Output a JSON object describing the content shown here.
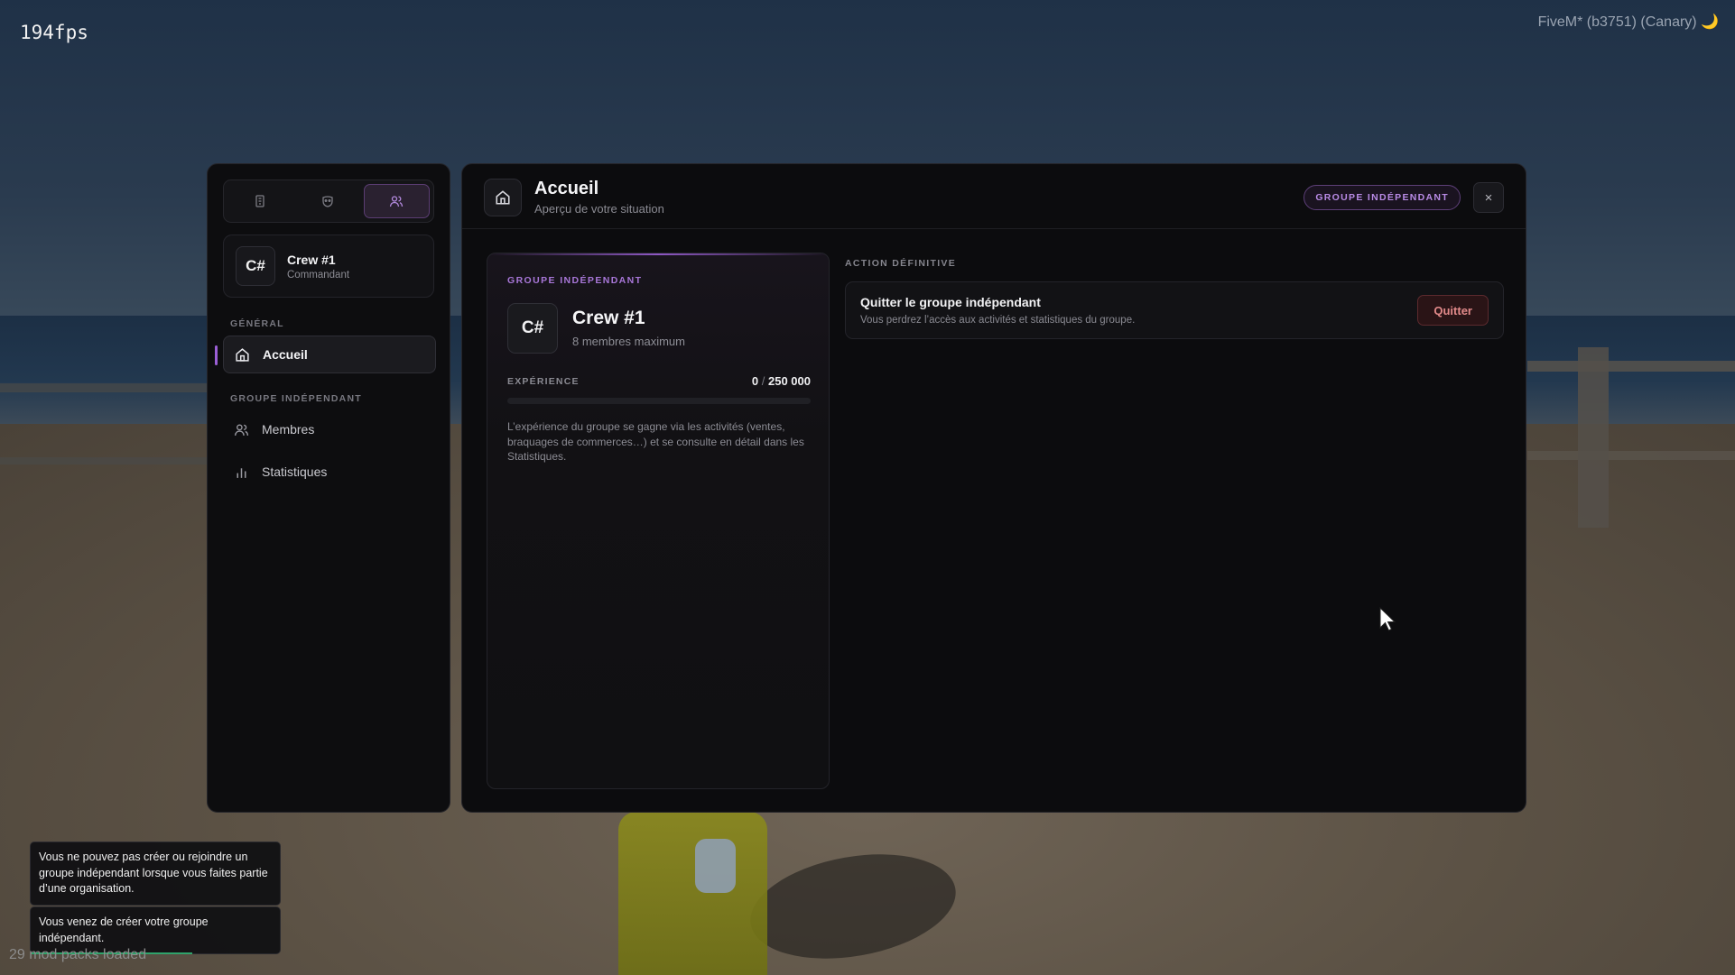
{
  "overlay": {
    "fps": "194fps",
    "client": "FiveM* (b3751) (Canary) 🌙",
    "modpacks": "29 mod packs loaded"
  },
  "sidebar": {
    "tabs": [
      {
        "icon": "building-icon",
        "active": false
      },
      {
        "icon": "mask-icon",
        "active": false
      },
      {
        "icon": "users-icon",
        "active": true
      }
    ],
    "crew": {
      "badge": "C#",
      "name": "Crew #1",
      "role": "Commandant"
    },
    "sections": [
      {
        "label": "GÉNÉRAL",
        "items": [
          {
            "label": "Accueil",
            "icon": "home-icon",
            "active": true
          }
        ]
      },
      {
        "label": "GROUPE INDÉPENDANT",
        "items": [
          {
            "label": "Membres",
            "icon": "users-icon",
            "active": false
          },
          {
            "label": "Statistiques",
            "icon": "bar-chart-icon",
            "active": false
          }
        ]
      }
    ]
  },
  "header": {
    "title": "Accueil",
    "subtitle": "Aperçu de votre situation",
    "badge": "GROUPE INDÉPENDANT",
    "close": "×"
  },
  "group_card": {
    "label": "GROUPE INDÉPENDANT",
    "badge": "C#",
    "name": "Crew #1",
    "max_members": "8 membres maximum",
    "xp_label": "EXPÉRIENCE",
    "xp_current": "0",
    "xp_sep": "/",
    "xp_max": "250 000",
    "xp_fraction": 0,
    "description": "L’expérience du groupe se gagne via les activités (ventes, braquages de commerces…) et se consulte en détail dans les Statistiques."
  },
  "action": {
    "label": "ACTION DÉFINITIVE",
    "title": "Quitter le groupe indépendant",
    "subtitle": "Vous perdrez l’accès aux activités et statistiques du groupe.",
    "button": "Quitter"
  },
  "notifications": [
    {
      "text": "Vous ne pouvez pas créer ou rejoindre un groupe indépendant lorsque vous faites partie d’une organisation."
    },
    {
      "text": "Vous venez de créer votre groupe indépendant.",
      "progress": 0.65
    }
  ],
  "colors": {
    "accent": "#9b5fd6",
    "danger": "#e28a8a"
  }
}
